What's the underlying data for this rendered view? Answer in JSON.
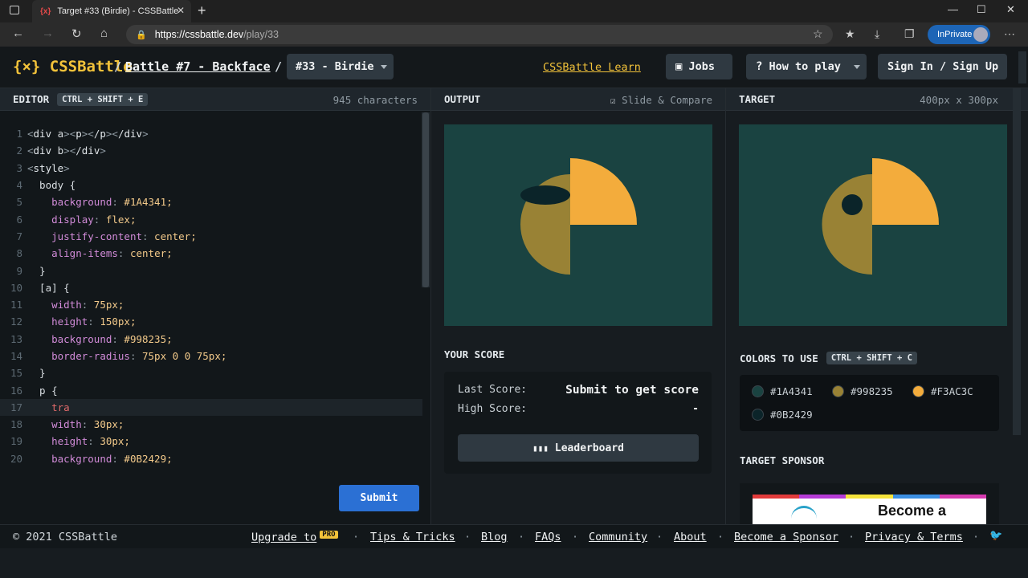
{
  "browser": {
    "tab_title": "Target #33 (Birdie) - CSSBattle",
    "tab_favicon": "{x}",
    "url_host": "https://cssbattle.dev",
    "url_path": "/play/33",
    "inprivate_label": "InPrivate"
  },
  "header": {
    "logo": "{⨯} CSSBattle",
    "sep": "/",
    "battle": "Battle #7 - Backface",
    "level": "#33 - Birdie",
    "learn": "CSSBattle Learn",
    "jobs": "Jobs",
    "howto": "How to play",
    "signin": "Sign In / Sign Up"
  },
  "editor": {
    "title": "EDITOR",
    "shortcut": "CTRL + SHIFT + E",
    "chars": "945 characters",
    "submit": "Submit",
    "lines": [
      {
        "n": "1",
        "t": "<div a><p></p></div>"
      },
      {
        "n": "2",
        "t": "<div b></div>"
      },
      {
        "n": "3",
        "t": "<style>"
      },
      {
        "n": "4",
        "t": "  body {"
      },
      {
        "n": "5",
        "t": "    background: #1A4341;"
      },
      {
        "n": "6",
        "t": "    display: flex;"
      },
      {
        "n": "7",
        "t": "    justify-content: center;"
      },
      {
        "n": "8",
        "t": "    align-items: center;"
      },
      {
        "n": "9",
        "t": "  }"
      },
      {
        "n": "10",
        "t": "  [a] {"
      },
      {
        "n": "11",
        "t": "    width: 75px;"
      },
      {
        "n": "12",
        "t": "    height: 150px;"
      },
      {
        "n": "13",
        "t": "    background: #998235;"
      },
      {
        "n": "14",
        "t": "    border-radius: 75px 0 0 75px;"
      },
      {
        "n": "15",
        "t": "  }"
      },
      {
        "n": "16",
        "t": "  p {"
      },
      {
        "n": "17",
        "t": "    tra"
      },
      {
        "n": "18",
        "t": "    width: 30px;"
      },
      {
        "n": "19",
        "t": "    height: 30px;"
      },
      {
        "n": "20",
        "t": "    background: #0B2429;"
      }
    ]
  },
  "output": {
    "title": "OUTPUT",
    "slide": "Slide & Compare",
    "your_score": "YOUR SCORE",
    "last_label": "Last Score:",
    "last_value": "Submit to get score",
    "high_label": "High Score:",
    "high_value": "-",
    "leaderboard": "Leaderboard"
  },
  "target": {
    "title": "TARGET",
    "size": "400px x 300px",
    "colors_label": "COLORS TO USE",
    "colors_shortcut": "CTRL + SHIFT + C",
    "colors": [
      "#1A4341",
      "#998235",
      "#F3AC3C",
      "#0B2429"
    ],
    "sponsor_label": "TARGET SPONSOR",
    "sponsor_text": "Become a"
  },
  "footer": {
    "copyright": "© 2021 CSSBattle",
    "upgrade": "Upgrade to",
    "pro": "PRO",
    "tips": "Tips & Tricks",
    "blog": "Blog",
    "faqs": "FAQs",
    "community": "Community",
    "about": "About",
    "sponsor": "Become a Sponsor",
    "privacy": "Privacy & Terms",
    "sep": "·"
  }
}
